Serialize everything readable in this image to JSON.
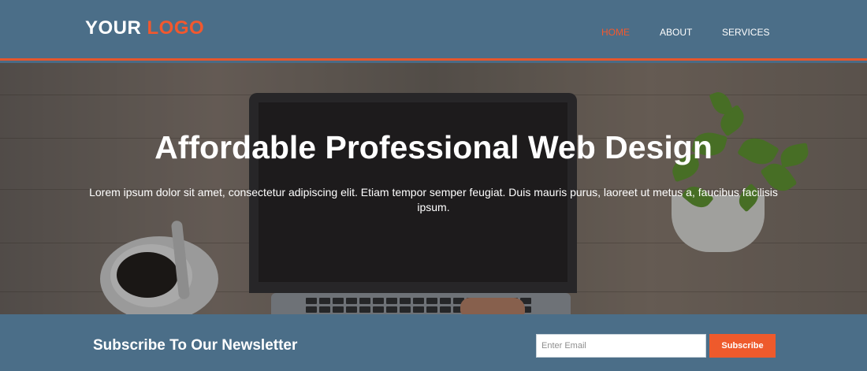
{
  "colors": {
    "header_bg": "#4b6e88",
    "accent": "#f2582e",
    "text": "#ffffff"
  },
  "header": {
    "logo_primary": "YOUR",
    "logo_accent": "LOGO",
    "nav": [
      {
        "label": "HOME",
        "active": true
      },
      {
        "label": "ABOUT",
        "active": false
      },
      {
        "label": "SERVICES",
        "active": false
      }
    ]
  },
  "hero": {
    "title": "Affordable Professional Web Design",
    "text": "Lorem ipsum dolor sit amet, consectetur adipiscing elit. Etiam tempor semper feugiat. Duis mauris purus, laoreet ut metus a, faucibus facilisis ipsum."
  },
  "newsletter": {
    "title": "Subscribe To Our Newsletter",
    "email_placeholder": "Enter Email",
    "email_value": "",
    "button_label": "Subscribe"
  }
}
